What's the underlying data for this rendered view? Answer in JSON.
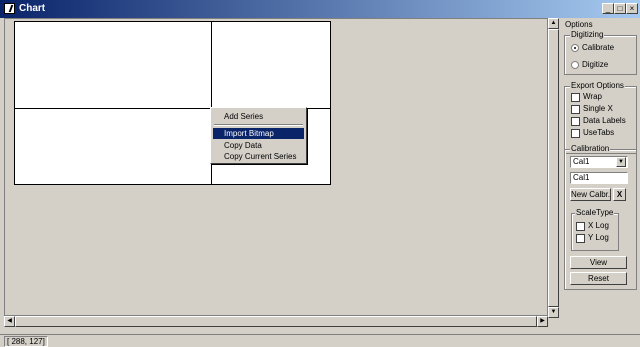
{
  "window": {
    "title": "Chart",
    "min_label": "_",
    "max_label": "□",
    "close_label": "×"
  },
  "context_menu": {
    "items": [
      "Add Series",
      "Import Bitmap",
      "Copy Data",
      "Copy Current Series"
    ],
    "selected": "Import Bitmap"
  },
  "options": {
    "title": "Options",
    "digitizing": {
      "title": "Digitizing",
      "calibrate": "Calibrate",
      "digitize": "Digitize",
      "selected": "Calibrate"
    },
    "export": {
      "title": "Export Options",
      "wrap": "Wrap",
      "single_x": "Single X",
      "data_labels": "Data Labels",
      "use_tabs": "UseTabs"
    },
    "calibration": {
      "title": "Calibration",
      "selected_value": "Cal1",
      "name_value": "Cal1",
      "new_button": "New Calbr.",
      "delete_button": "X"
    },
    "scale_type": {
      "title": "ScaleType",
      "x_log": "X Log",
      "y_log": "Y Log"
    },
    "view_button": "View",
    "reset_button": "Reset"
  },
  "status": {
    "coordinates": "[ 288, 127]"
  }
}
